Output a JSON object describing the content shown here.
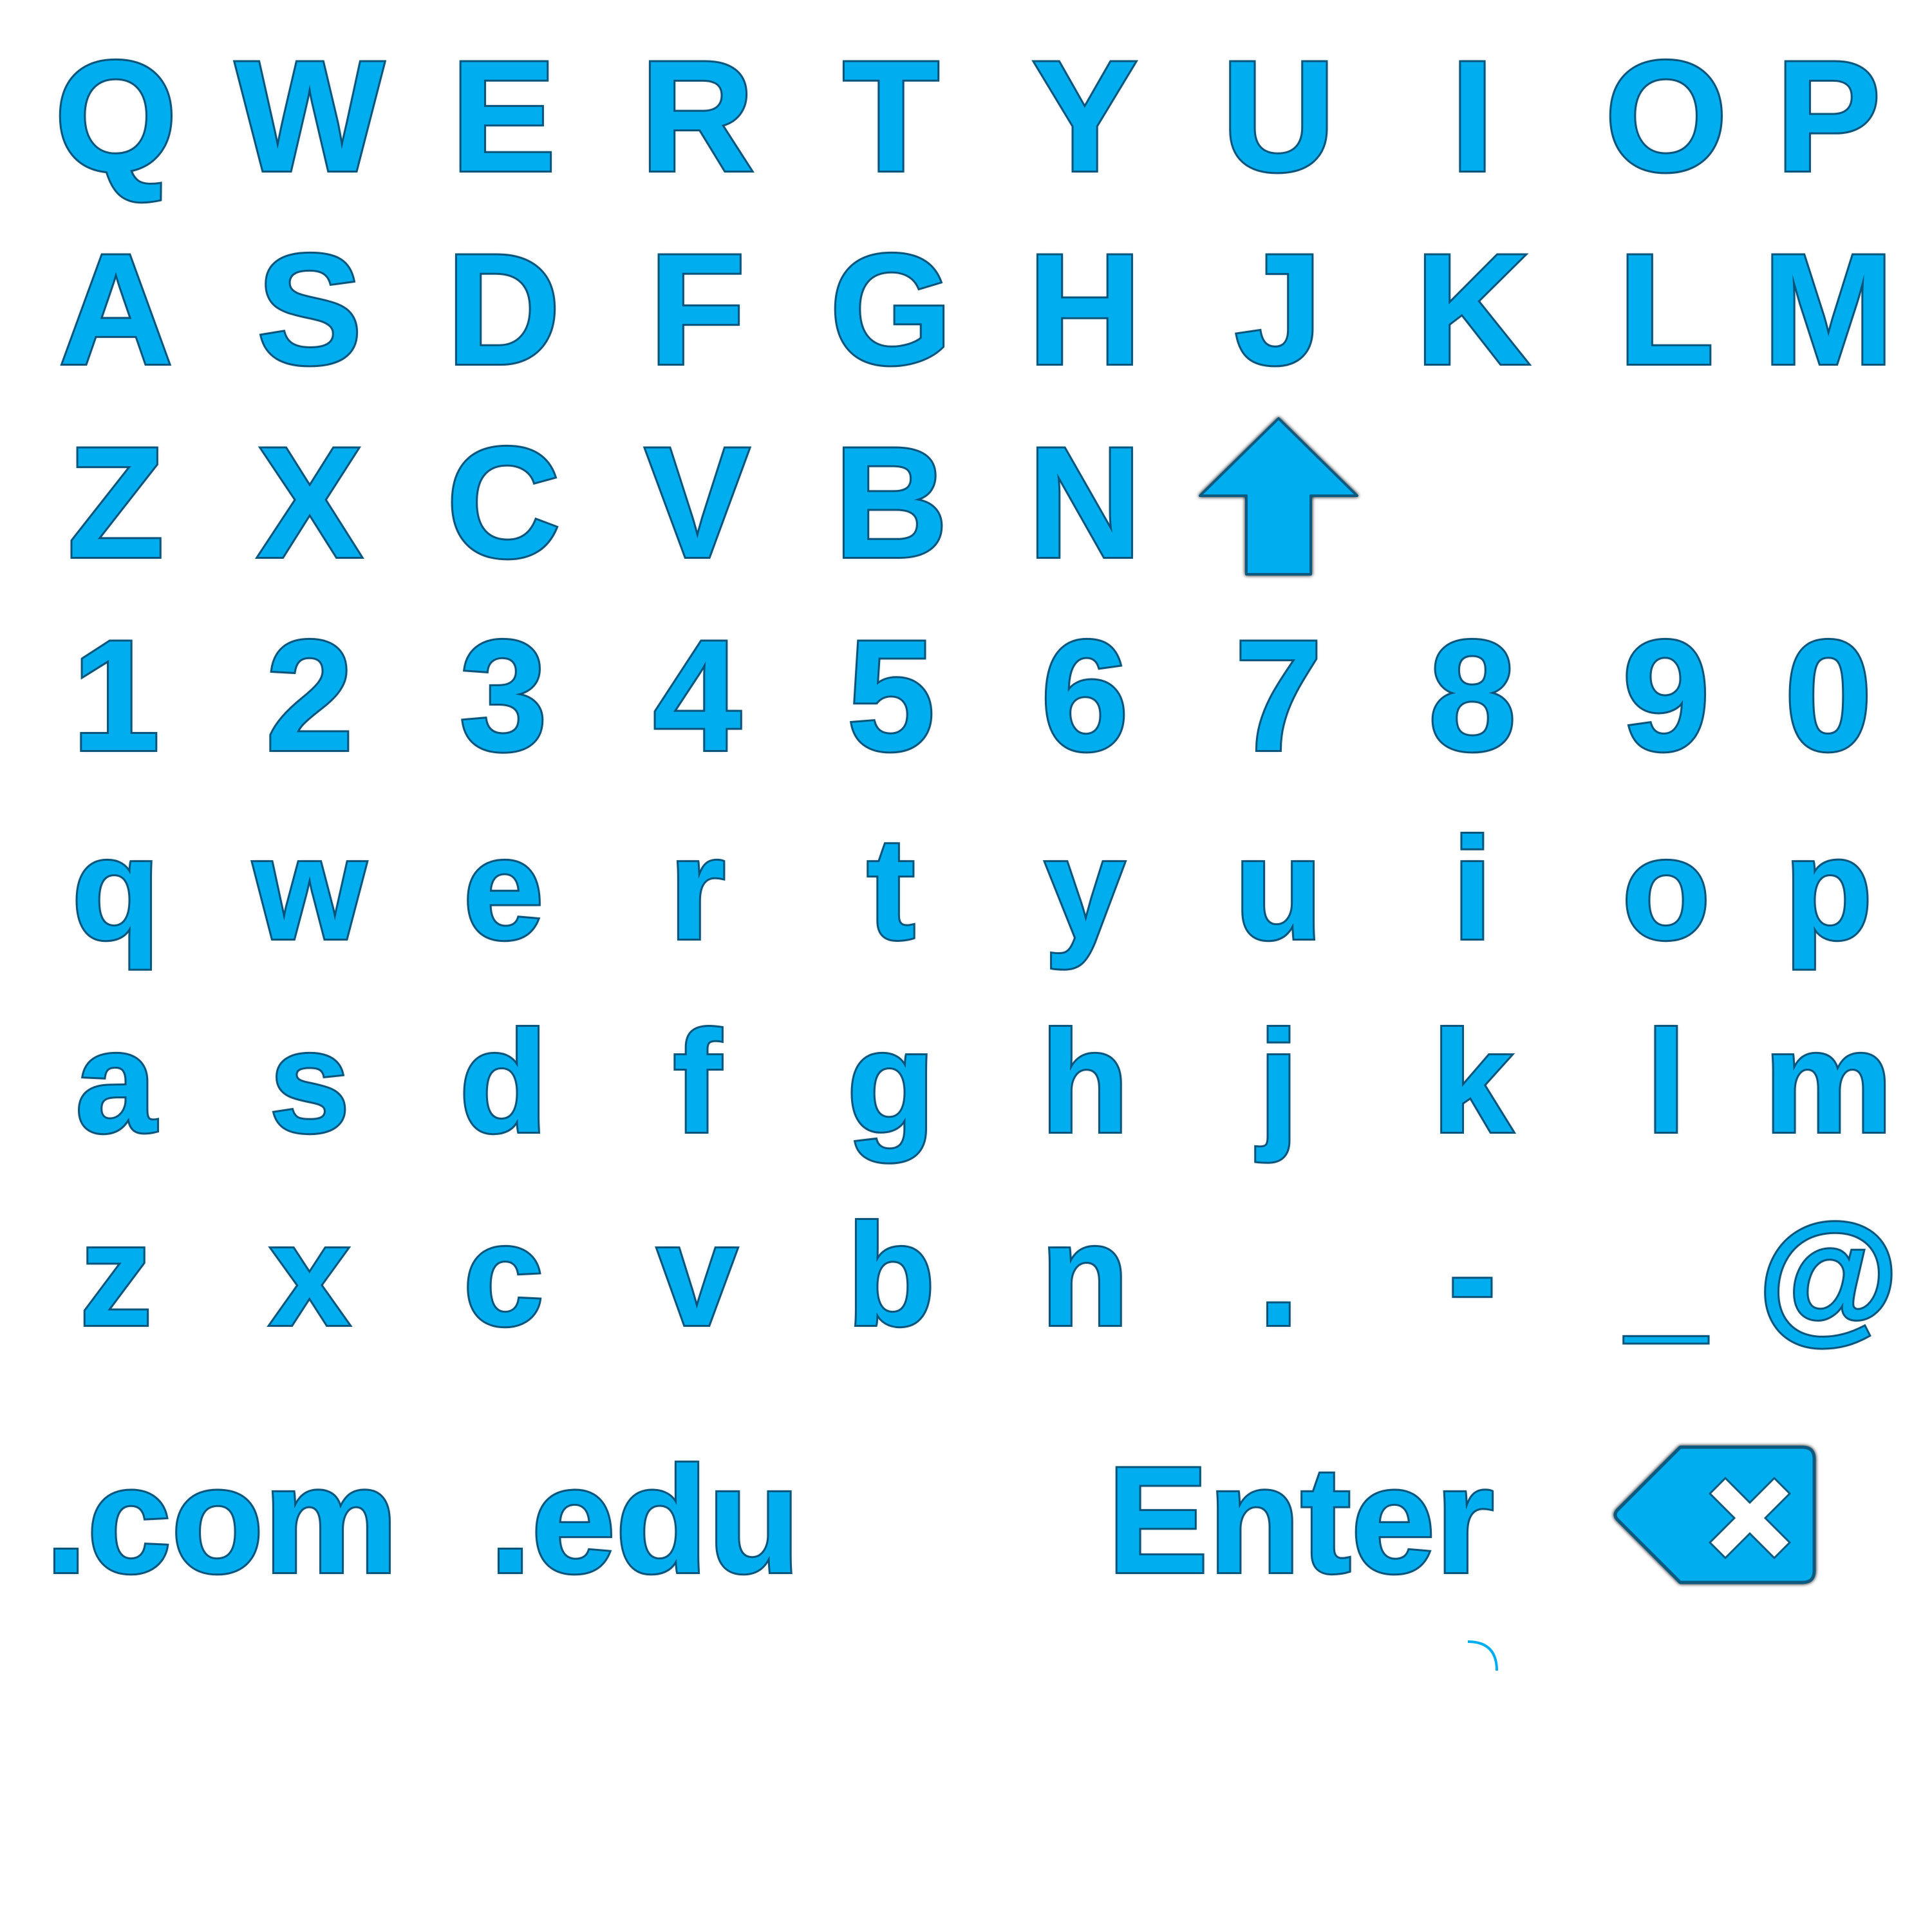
{
  "keyboard": {
    "accent_color": "#00aeef",
    "outline_color": "#0c5a80",
    "rows": [
      {
        "name": "upper-row-1",
        "keys": [
          "Q",
          "W",
          "E",
          "R",
          "T",
          "Y",
          "U",
          "I",
          "O",
          "P"
        ]
      },
      {
        "name": "upper-row-2",
        "keys": [
          "A",
          "S",
          "D",
          "F",
          "G",
          "H",
          "J",
          "K",
          "L",
          "M"
        ]
      },
      {
        "name": "upper-row-3",
        "keys": [
          "Z",
          "X",
          "C",
          "V",
          "B",
          "N"
        ]
      },
      {
        "name": "number-row",
        "keys": [
          "1",
          "2",
          "3",
          "4",
          "5",
          "6",
          "7",
          "8",
          "9",
          "0"
        ]
      },
      {
        "name": "lower-row-1",
        "keys": [
          "q",
          "w",
          "e",
          "r",
          "t",
          "y",
          "u",
          "i",
          "o",
          "p"
        ]
      },
      {
        "name": "lower-row-2",
        "keys": [
          "a",
          "s",
          "d",
          "f",
          "g",
          "h",
          "j",
          "k",
          "l",
          "m"
        ]
      },
      {
        "name": "lower-row-3",
        "keys": [
          "z",
          "x",
          "c",
          "v",
          "b",
          "n",
          ".",
          "-",
          "_",
          "@"
        ]
      }
    ],
    "shift_icon": "shift-up-arrow-icon",
    "special": {
      "dotcom_label": ".com",
      "dotedu_label": ".edu",
      "enter_label": "Enter",
      "backspace_icon": "backspace-icon"
    },
    "text_field": {
      "value": ""
    }
  }
}
